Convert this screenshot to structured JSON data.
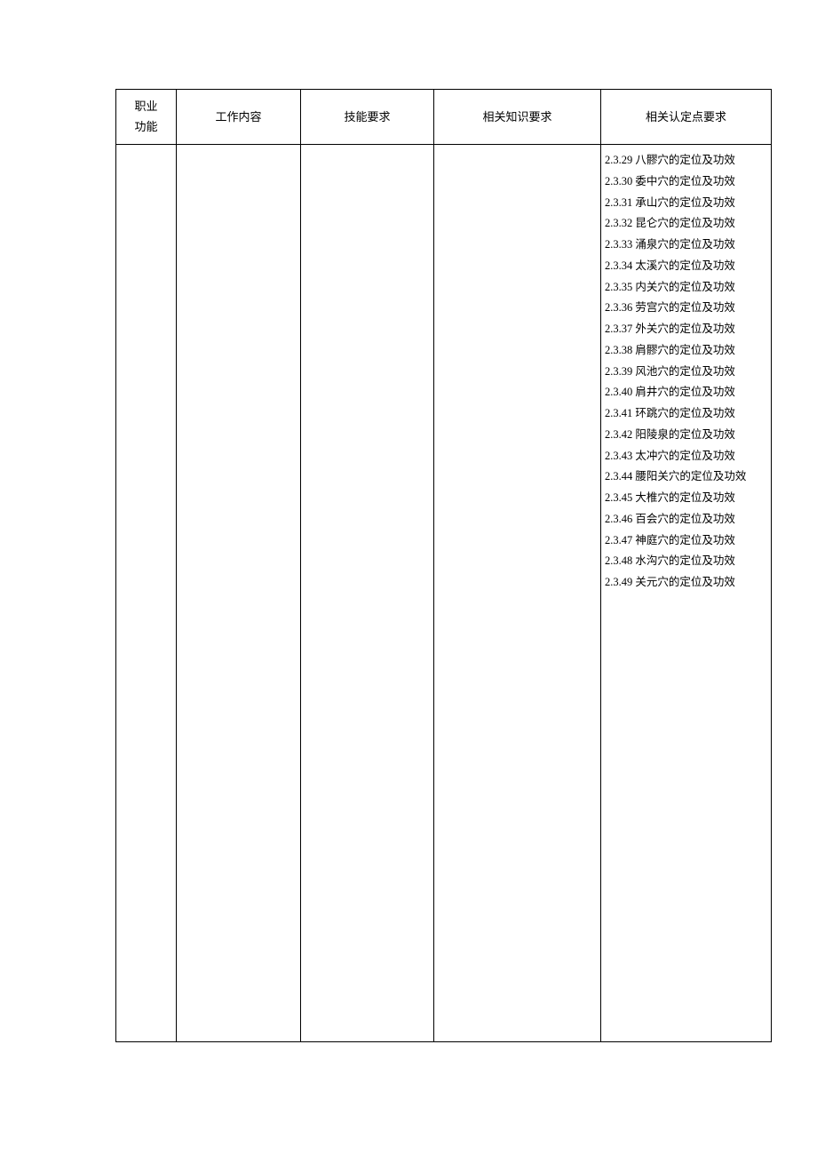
{
  "headers": {
    "col1_line1": "职业",
    "col1_line2": "功能",
    "col2": "工作内容",
    "col3": "技能要求",
    "col4": "相关知识要求",
    "col5": "相关认定点要求"
  },
  "requirements": [
    "2.3.29 八髎穴的定位及功效",
    "2.3.30 委中穴的定位及功效",
    "2.3.31 承山穴的定位及功效",
    "2.3.32 昆仑穴的定位及功效",
    "2.3.33 涌泉穴的定位及功效",
    "2.3.34 太溪穴的定位及功效",
    "2.3.35 内关穴的定位及功效",
    "2.3.36 劳宫穴的定位及功效",
    "2.3.37 外关穴的定位及功效",
    "2.3.38 肩髎穴的定位及功效",
    "2.3.39 风池穴的定位及功效",
    "2.3.40 肩井穴的定位及功效",
    "2.3.41 环跳穴的定位及功效",
    "2.3.42 阳陵泉的定位及功效",
    "2.3.43 太冲穴的定位及功效",
    "2.3.44 腰阳关穴的定位及功效",
    "2.3.45 大椎穴的定位及功效",
    "2.3.46 百会穴的定位及功效",
    "2.3.47 神庭穴的定位及功效",
    "2.3.48 水沟穴的定位及功效",
    "2.3.49 关元穴的定位及功效"
  ]
}
